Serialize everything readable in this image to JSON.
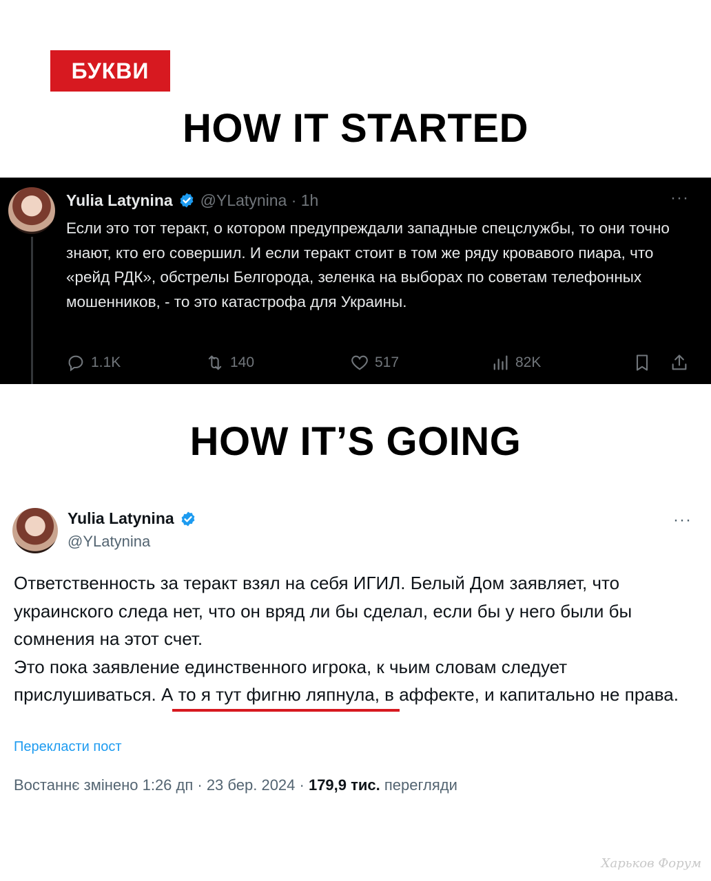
{
  "brand": {
    "logo_text": "БУКВИ",
    "color": "#d71920"
  },
  "headings": {
    "top": "HOW IT STARTED",
    "middle": "HOW IT’S GOING"
  },
  "tweet_old": {
    "name": "Yulia Latynina",
    "handle_time": "@YLatynina · 1h",
    "more": "···",
    "text": "Если это тот теракт, о котором предупреждали западные спецслужбы, то они точно знают, кто его совершил. И если теракт стоит в том же ряду кровавого пиара, что «рейд РДК», обстрелы Белгорода, зеленка на выборах по советам телефонных мошенников, - то это катастрофа для Украины.",
    "stats": {
      "replies": "1.1K",
      "reposts": "140",
      "likes": "517",
      "views": "82K"
    },
    "theme": {
      "background": "#000000",
      "text": "#e7e9ea",
      "muted": "#71767b"
    }
  },
  "tweet_new": {
    "name": "Yulia Latynina",
    "handle": "@YLatynina",
    "more": "···",
    "paragraph1": "Ответственность за теракт взял на себя ИГИЛ. Белый Дом заявляет, что украинского следа нет, что он вряд ли бы сделал, если бы у него были бы сомнения на этот счет.",
    "paragraph2": "Это пока заявление единственного игрока, к чьим словам следует прислушиваться. А то я тут фигню  ляпнула, в аффекте, и капитально не права.",
    "translate": "Перекласти пост",
    "edited_time": "Востаннє змінено 1:26 дп · 23 бер. 2024 · ",
    "views_count": "179,9 тис.",
    "views_label": " перегляди"
  },
  "verified_color": "#1d9bf0",
  "watermark": "Харьков Форум"
}
